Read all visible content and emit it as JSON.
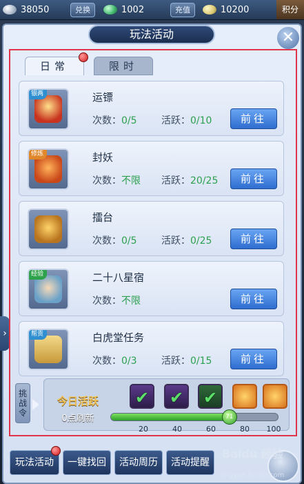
{
  "topbar": {
    "silver": "38050",
    "exchange_label": "兑换",
    "jade": "1002",
    "recharge_label": "充值",
    "gold": "10200",
    "score_label": "积分"
  },
  "window": {
    "title": "玩法活动"
  },
  "tabs": [
    {
      "label": "日常"
    },
    {
      "label": "限时"
    }
  ],
  "activities": [
    {
      "title": "运镖",
      "badge": "银两",
      "count_label": "次数：",
      "count": "0/5",
      "active_label": "活跃：",
      "active": "0/10",
      "go_label": "前往"
    },
    {
      "title": "封妖",
      "badge": "修炼",
      "count_label": "次数：",
      "count": "不限",
      "active_label": "活跃：",
      "active": "20/25",
      "go_label": "前往"
    },
    {
      "title": "擂台",
      "badge": "",
      "count_label": "次数：",
      "count": "0/5",
      "active_label": "活跃：",
      "active": "0/25",
      "go_label": "前往"
    },
    {
      "title": "二十八星宿",
      "badge": "经验",
      "count_label": "次数：",
      "count": "不限",
      "go_label": "前往"
    },
    {
      "title": "白虎堂任务",
      "badge": "帮贡",
      "count_label": "次数：",
      "count": "0/3",
      "active_label": "活跃：",
      "active": "0/15",
      "go_label": "前往"
    }
  ],
  "activity_panel": {
    "challenge_label": "挑战令",
    "title": "今日活跃",
    "subtitle": "0点刷新",
    "progress_value": 71,
    "progress_max": 100,
    "ticks": [
      "20",
      "40",
      "60",
      "80",
      "100"
    ]
  },
  "bottom_buttons": [
    {
      "label": "玩法活动"
    },
    {
      "label": "一键找回"
    },
    {
      "label": "活动周历"
    },
    {
      "label": "活动提醒"
    }
  ],
  "watermark": {
    "text": "Baidu 经验",
    "sub": "jingyan.baidu.com"
  },
  "colors": {
    "accent": "#2f6dd0",
    "success": "#2ca04f",
    "highlight": "#e0344a"
  }
}
